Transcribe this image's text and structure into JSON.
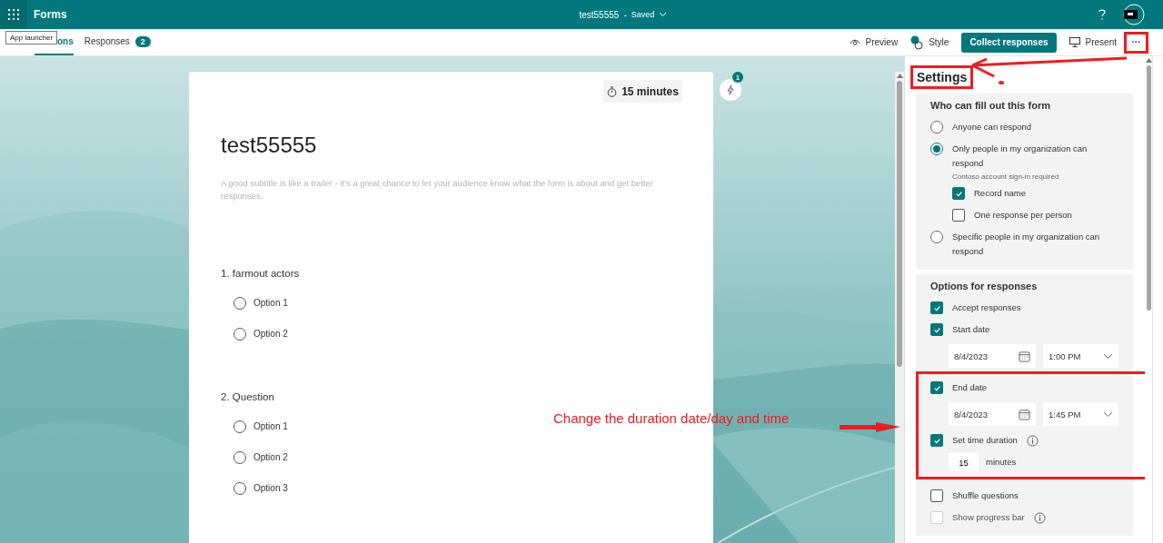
{
  "app_bar": {
    "app_name": "Forms",
    "doc_title": "test55555",
    "separator": "-",
    "save_state": "Saved"
  },
  "tooltip": "App launcher",
  "tabs": [
    {
      "label": "ons",
      "selected": true
    },
    {
      "label": "Responses",
      "selected": false,
      "count": "2"
    }
  ],
  "toolbar": {
    "preview": "Preview",
    "style": "Style",
    "collect": "Collect responses",
    "present": "Present",
    "more": "···"
  },
  "form": {
    "timer": "15 minutes",
    "title": "test55555",
    "subtitle": "A good subtitle is like a trailer - it's a great chance to let your audience know what the form is about and get better responses.",
    "ideas_count": "1",
    "questions": [
      {
        "number": "1.",
        "text": "farmout actors",
        "options": [
          {
            "label": "Option 1",
            "selected": false
          },
          {
            "label": "Option 2",
            "selected": false
          }
        ]
      },
      {
        "number": "2.",
        "text": "Question",
        "options": [
          {
            "label": "Option 1",
            "selected": false
          },
          {
            "label": "Option 2",
            "selected": false
          },
          {
            "label": "Option 3",
            "selected": false
          }
        ]
      }
    ]
  },
  "settings": {
    "title": "Settings",
    "sections": [
      {
        "title": "Who can fill out this form",
        "items": [
          {
            "kind": "radio",
            "label": "Anyone can respond",
            "selected": false
          },
          {
            "kind": "radio",
            "label": "Only people in my organization can respond",
            "selected": true,
            "note": "Contoso account sign-in required",
            "children": [
              {
                "kind": "checkbox",
                "label": "Record name",
                "checked": true
              },
              {
                "kind": "checkbox",
                "label": "One response per person",
                "checked": false
              }
            ]
          },
          {
            "kind": "radio",
            "label": "Specific people in my organization can respond",
            "selected": false
          }
        ]
      },
      {
        "title": "Options for responses",
        "items": [
          {
            "kind": "checkbox",
            "label": "Accept responses",
            "checked": true
          },
          {
            "kind": "checkbox",
            "label": "Start date",
            "checked": true
          },
          {
            "kind": "datetime",
            "date": "8/4/2023",
            "time": "1:00 PM"
          },
          {
            "kind": "group",
            "highlighted": true,
            "children": [
              {
                "kind": "checkbox",
                "label": "End date",
                "checked": true
              },
              {
                "kind": "datetime",
                "date": "8/4/2023",
                "time": "1:45 PM"
              },
              {
                "kind": "checkbox",
                "label": "Set time duration",
                "checked": true,
                "info": true
              },
              {
                "kind": "duration",
                "value": "15",
                "unit": "minutes"
              }
            ]
          },
          {
            "kind": "checkbox",
            "label": "Shuffle questions",
            "checked": false
          },
          {
            "kind": "checkbox",
            "label": "Show progress bar",
            "checked": false,
            "disabled": true,
            "info": true
          }
        ]
      }
    ]
  },
  "annotation": {
    "text": "Change the duration date/day and time"
  }
}
